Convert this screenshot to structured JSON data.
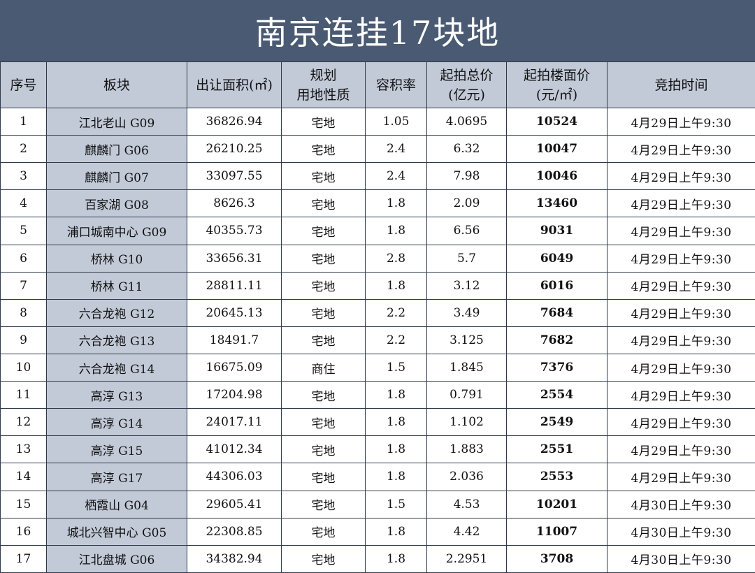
{
  "title": "南京连挂17块地",
  "headers": {
    "idx": "序号",
    "block": "板块",
    "area": "出让面积(㎡)",
    "use_line1": "规划",
    "use_line2": "用地性质",
    "far": "容积率",
    "start_total_line1": "起拍总价",
    "start_total_line2": "(亿元)",
    "floor_price_line1": "起拍楼面价",
    "floor_price_line2": "(元/㎡)",
    "time": "竞拍时间"
  },
  "rows": [
    {
      "idx": "1",
      "block": "江北老山 G09",
      "area": "36826.94",
      "use": "宅地",
      "far": "1.05",
      "price": "4.0695",
      "floor": "10524",
      "time": "4月29日上午9:30"
    },
    {
      "idx": "2",
      "block": "麒麟门 G06",
      "area": "26210.25",
      "use": "宅地",
      "far": "2.4",
      "price": "6.32",
      "floor": "10047",
      "time": "4月29日上午9:30"
    },
    {
      "idx": "3",
      "block": "麒麟门 G07",
      "area": "33097.55",
      "use": "宅地",
      "far": "2.4",
      "price": "7.98",
      "floor": "10046",
      "time": "4月29日上午9:30"
    },
    {
      "idx": "4",
      "block": "百家湖 G08",
      "area": "8626.3",
      "use": "宅地",
      "far": "1.8",
      "price": "2.09",
      "floor": "13460",
      "time": "4月29日上午9:30"
    },
    {
      "idx": "5",
      "block": "浦口城南中心 G09",
      "area": "40355.73",
      "use": "宅地",
      "far": "1.8",
      "price": "6.56",
      "floor": "9031",
      "time": "4月29日上午9:30"
    },
    {
      "idx": "6",
      "block": "桥林 G10",
      "area": "33656.31",
      "use": "宅地",
      "far": "2.8",
      "price": "5.7",
      "floor": "6049",
      "time": "4月29日上午9:30"
    },
    {
      "idx": "7",
      "block": "桥林 G11",
      "area": "28811.11",
      "use": "宅地",
      "far": "1.8",
      "price": "3.12",
      "floor": "6016",
      "time": "4月29日上午9:30"
    },
    {
      "idx": "8",
      "block": "六合龙袍 G12",
      "area": "20645.13",
      "use": "宅地",
      "far": "2.2",
      "price": "3.49",
      "floor": "7684",
      "time": "4月29日上午9:30"
    },
    {
      "idx": "9",
      "block": "六合龙袍 G13",
      "area": "18491.7",
      "use": "宅地",
      "far": "2.2",
      "price": "3.125",
      "floor": "7682",
      "time": "4月29日上午9:30"
    },
    {
      "idx": "10",
      "block": "六合龙袍 G14",
      "area": "16675.09",
      "use": "商住",
      "far": "1.5",
      "price": "1.845",
      "floor": "7376",
      "time": "4月29日上午9:30"
    },
    {
      "idx": "11",
      "block": "高淳 G13",
      "area": "17204.98",
      "use": "宅地",
      "far": "1.8",
      "price": "0.791",
      "floor": "2554",
      "time": "4月29日上午9:30"
    },
    {
      "idx": "12",
      "block": "高淳 G14",
      "area": "24017.11",
      "use": "宅地",
      "far": "1.8",
      "price": "1.102",
      "floor": "2549",
      "time": "4月29日上午9:30"
    },
    {
      "idx": "13",
      "block": "高淳 G15",
      "area": "41012.34",
      "use": "宅地",
      "far": "1.8",
      "price": "1.883",
      "floor": "2551",
      "time": "4月29日上午9:30"
    },
    {
      "idx": "14",
      "block": "高淳 G17",
      "area": "44306.03",
      "use": "宅地",
      "far": "1.8",
      "price": "2.036",
      "floor": "2553",
      "time": "4月29日上午9:30"
    },
    {
      "idx": "15",
      "block": "栖霞山 G04",
      "area": "29605.41",
      "use": "宅地",
      "far": "1.5",
      "price": "4.53",
      "floor": "10201",
      "time": "4月30日上午9:30"
    },
    {
      "idx": "16",
      "block": "城北兴智中心 G05",
      "area": "22308.85",
      "use": "宅地",
      "far": "1.8",
      "price": "4.42",
      "floor": "11007",
      "time": "4月30日上午9:30"
    },
    {
      "idx": "17",
      "block": "江北盘城 G06",
      "area": "34382.94",
      "use": "宅地",
      "far": "1.8",
      "price": "2.2951",
      "floor": "3708",
      "time": "4月30日上午9:30"
    }
  ],
  "colors": {
    "title_bg": "#4a5a72",
    "header_bg": "#c2cad8",
    "accent_far": "#3d6fa6",
    "accent_floor": "#2f6799"
  }
}
